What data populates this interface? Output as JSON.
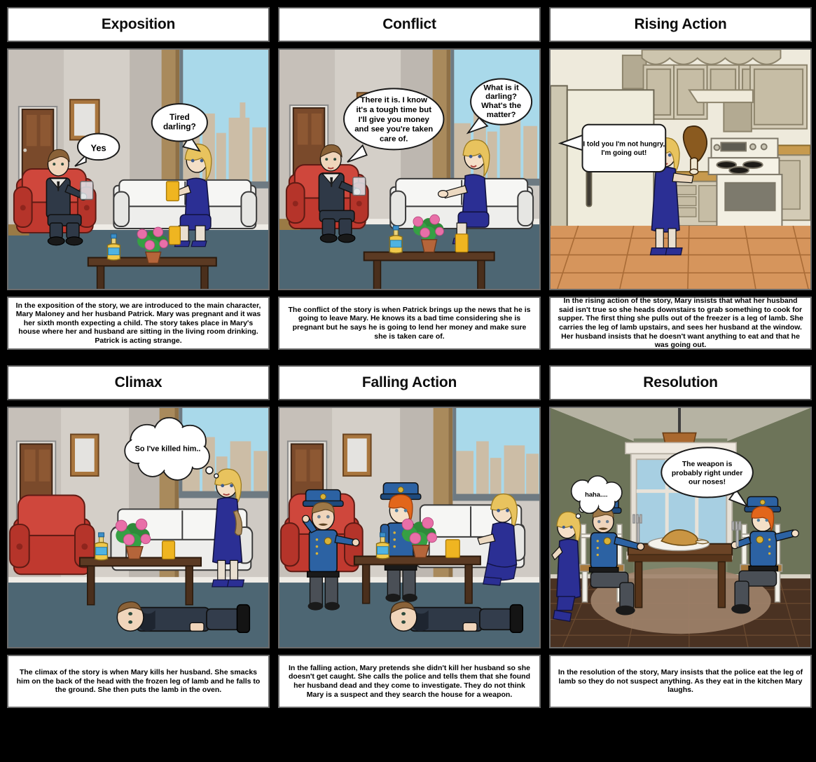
{
  "storyboard": {
    "layout": {
      "rows": 2,
      "columns": 3
    },
    "panels": [
      {
        "id": "exposition",
        "title": "Exposition",
        "scene": "living-room",
        "caption": "In the exposition of the story, we are introduced to the main character, Mary Maloney and her husband Patrick. Mary was pregnant and it was her sixth month expecting a child. The story takes place in Mary's house where her and husband are sitting in the living room drinking. Patrick is acting strange.",
        "bubbles": [
          {
            "id": "yes-bubble",
            "type": "speech",
            "text": "Yes",
            "speaker": "patrick"
          },
          {
            "id": "tired-bubble",
            "type": "speech",
            "text": "Tired darling?",
            "speaker": "mary"
          }
        ]
      },
      {
        "id": "conflict",
        "title": "Conflict",
        "scene": "living-room",
        "caption": "The conflict of the story is when Patrick brings up the news that he is going to leave Mary. He knows its a bad time considering she is pregnant but he says he is going to lend her money and make sure she is taken care of.",
        "bubbles": [
          {
            "id": "there-it-is-bubble",
            "type": "speech",
            "text": "There it is. I know it's a tough time but I'll give you money and see you're taken care of.",
            "speaker": "patrick"
          },
          {
            "id": "what-is-it-bubble",
            "type": "speech",
            "text": "What is it darling? What's the matter?",
            "speaker": "mary"
          }
        ]
      },
      {
        "id": "rising-action",
        "title": "Rising Action",
        "scene": "kitchen",
        "caption": "In the rising action of the story, Mary insists that what her husband said isn't true so she heads downstairs to grab something to cook for supper. The first thing she pulls out of the freezer is a leg of lamb. She carries the leg of lamb upstairs, and sees her husband at the window. Her husband insists that he doesn't want anything to eat and that he was going out.",
        "bubbles": [
          {
            "id": "not-hungry-bubble",
            "type": "speech-box",
            "text": "I told you I'm not hungry, I'm going out!",
            "speaker": "patrick"
          }
        ]
      },
      {
        "id": "climax",
        "title": "Climax",
        "scene": "living-room-body",
        "caption": "The climax of the story is when Mary kills her husband. She smacks him on the back of the head with the frozen leg of lamb and he falls to the ground. She then puts the lamb in the oven.",
        "bubbles": [
          {
            "id": "killed-him-bubble",
            "type": "thought",
            "text": "So I've killed him..",
            "speaker": "mary"
          }
        ]
      },
      {
        "id": "falling-action",
        "title": "Falling Action",
        "scene": "living-room-police",
        "caption": "In the falling action, Mary pretends she didn't kill her husband so she doesn't get caught. She calls the police and tells them that she found her husband dead and they come to investigate. They do not think Mary is a suspect and they search the house for a weapon.",
        "bubbles": []
      },
      {
        "id": "resolution",
        "title": "Resolution",
        "scene": "dining-room",
        "caption": "In the resolution of the story, Mary insists that the police eat the leg of lamb so they do not suspect anything. As they eat in the kitchen Mary laughs.",
        "bubbles": [
          {
            "id": "haha-bubble",
            "type": "thought",
            "text": "haha....",
            "speaker": "officer-1"
          },
          {
            "id": "weapon-bubble",
            "type": "speech",
            "text": "The weapon is probably right under our noses!",
            "speaker": "officer-2"
          }
        ]
      }
    ]
  },
  "bubble_lines": {
    "yes": [
      "Yes"
    ],
    "tired": [
      "Tired",
      "darling?"
    ],
    "there_it_is": [
      "There it is. I know",
      "it's a tough time but",
      "I'll give you money",
      "and see you're taken",
      "care of."
    ],
    "what_is_it": [
      "What is it",
      "darling?",
      "What's the",
      "matter?"
    ],
    "not_hungry": [
      "I told you I'm not hungry,",
      "I'm going out!"
    ],
    "killed_him": [
      "So I've killed him.."
    ],
    "haha": [
      "haha...."
    ],
    "weapon": [
      "The weapon is",
      "probably right under",
      "our noses!"
    ]
  },
  "colors": {
    "background": "#000000",
    "panel_border": "#6b6b6b",
    "panel_fill": "#ffffff",
    "text": "#000000",
    "wall_light": "#cfcac4",
    "wall_mid": "#b9b3ac",
    "floor_blue": "#4d6673",
    "chair_red": "#c0392f",
    "sofa_white": "#eeeeec",
    "sky_blue": "#a9d9ea",
    "city_tan": "#ccbda6",
    "suit_navy": "#2f3947",
    "dress_blue": "#2b2f94",
    "hair_blonde": "#e8c35e",
    "hair_ginger": "#e2661b",
    "police_blue": "#2c62a3",
    "police_pants": "#4a4f56",
    "kitchen_cream": "#ddd6c3",
    "kitchen_floor": "#d6955c",
    "dining_wall": "#7d846a",
    "dining_floor": "#4a3222",
    "wood_table": "#5b3a23",
    "plant_green": "#2f8a3a",
    "flower_pink": "#e86fa8",
    "glass_orange": "#efb521"
  }
}
